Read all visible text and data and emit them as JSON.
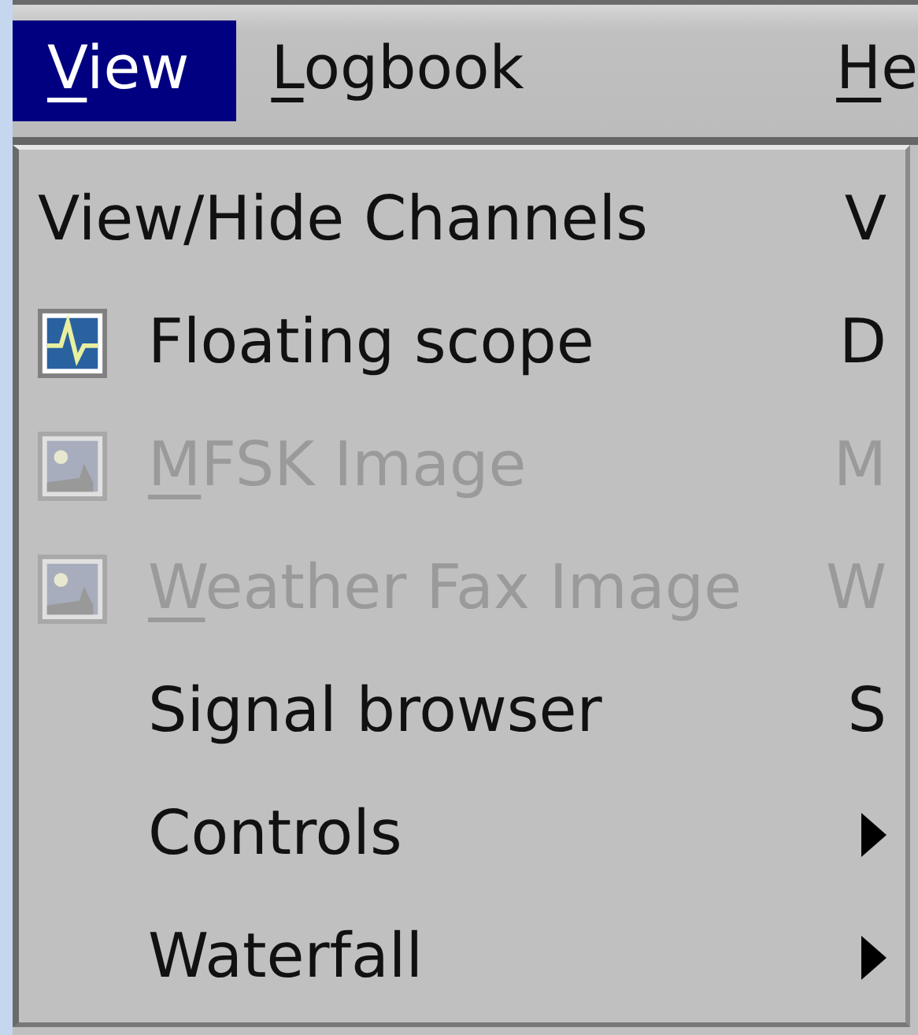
{
  "menubar": [
    {
      "label": "View",
      "selected": true,
      "underline_first": true
    },
    {
      "label": "Logbook",
      "selected": false,
      "underline_first": true
    },
    {
      "label": "He",
      "selected": false,
      "underline_first": true
    }
  ],
  "menu": {
    "items": [
      {
        "kind": "command",
        "label": "View/Hide Channels",
        "shortcut": "V",
        "disabled": false,
        "underline_first": false
      },
      {
        "kind": "scope",
        "label": "Floating scope",
        "shortcut": "D",
        "disabled": false,
        "underline_first": false
      },
      {
        "kind": "image",
        "label": "MFSK Image",
        "shortcut": "M",
        "disabled": true,
        "underline_first": true
      },
      {
        "kind": "image",
        "label": "Weather Fax Image",
        "shortcut": "W",
        "disabled": true,
        "underline_first": true
      },
      {
        "kind": "command",
        "label": "Signal browser",
        "shortcut": "S",
        "disabled": false,
        "underline_first": false
      },
      {
        "kind": "submenu",
        "label": "Controls",
        "disabled": false,
        "underline_first": false
      },
      {
        "kind": "submenu",
        "label": "Waterfall",
        "disabled": false,
        "underline_first": false
      }
    ]
  }
}
